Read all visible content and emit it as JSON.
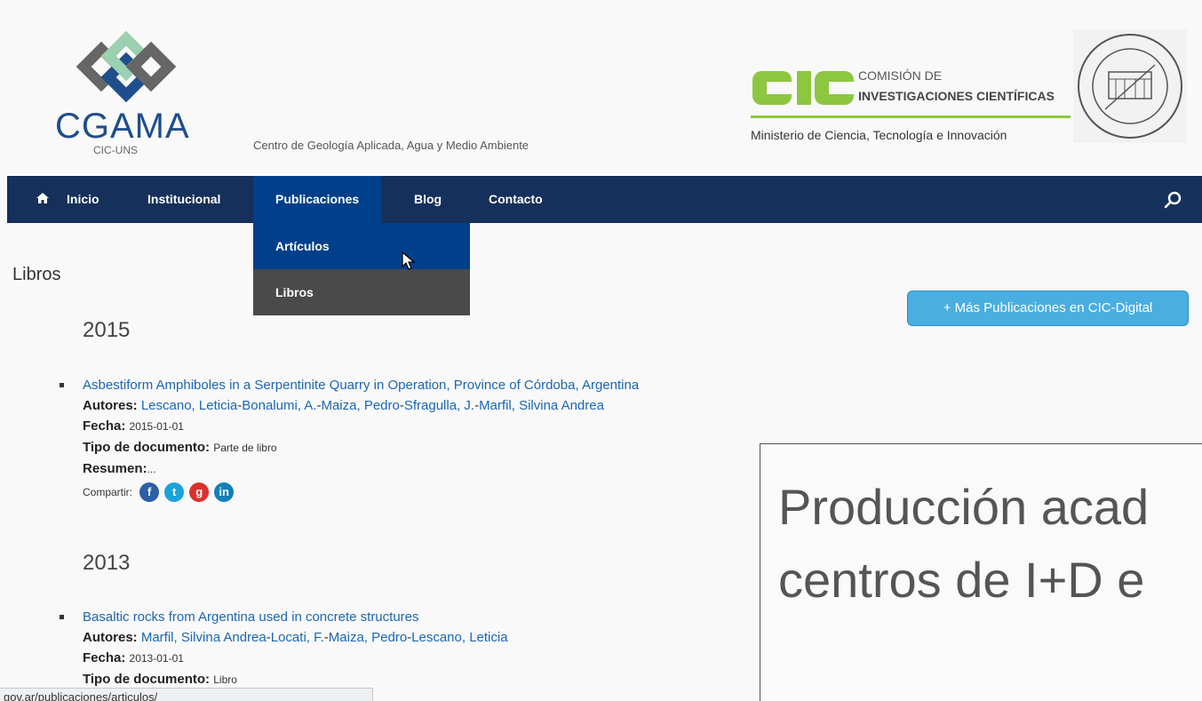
{
  "header": {
    "logo_title": "CGAMA",
    "logo_subtitle": "CIC-UNS",
    "center_name": "Centro de Geología Aplicada, Agua y Medio Ambiente",
    "cic_line1": "COMISIÓN DE",
    "cic_line2": "INVESTIGACIONES CIENTÍFICAS",
    "ministry": "Ministerio de Ciencia, Tecnología e Innovación"
  },
  "nav": {
    "items": [
      {
        "label": "Inicio"
      },
      {
        "label": "Institucional"
      },
      {
        "label": "Publicaciones"
      },
      {
        "label": "Blog"
      },
      {
        "label": "Contacto"
      }
    ],
    "dropdown": [
      {
        "label": "Artículos"
      },
      {
        "label": "Libros"
      }
    ]
  },
  "page": {
    "section_title": "Libros",
    "more_button": "+ Más Publicaciones en CIC-Digital",
    "labels": {
      "authors": "Autores:",
      "date": "Fecha:",
      "doctype": "Tipo de documento:",
      "abstract": "Resumen:",
      "share": "Compartir:"
    },
    "years": [
      {
        "year": "2015",
        "entry": {
          "title": "Asbestiform Amphiboles in a Serpentinite Quarry in Operation, Province of Córdoba, Argentina",
          "authors": [
            "Lescano, Leticia",
            "Bonalumi, A.",
            "Maiza, Pedro",
            "Sfragulla, J.",
            "Marfil, Silvina Andrea"
          ],
          "date": "2015-01-01",
          "doctype": "Parte de libro",
          "abstract": "..."
        }
      },
      {
        "year": "2013",
        "entry": {
          "title": "Basaltic rocks from Argentina used in concrete structures",
          "authors": [
            "Marfil, Silvina Andrea",
            "Locati, F.",
            "Maiza, Pedro",
            "Lescano, Leticia"
          ],
          "date": "2013-01-01",
          "doctype": "Libro"
        }
      }
    ],
    "banner_line1": "Producción acad",
    "banner_line2": "centros de I+D e"
  },
  "status_bar": "gov.ar/publicaciones/articulos/",
  "colors": {
    "nav_bg": "#15305a",
    "nav_active": "#003f8a",
    "link": "#1a66b3",
    "button": "#4aaee0"
  }
}
